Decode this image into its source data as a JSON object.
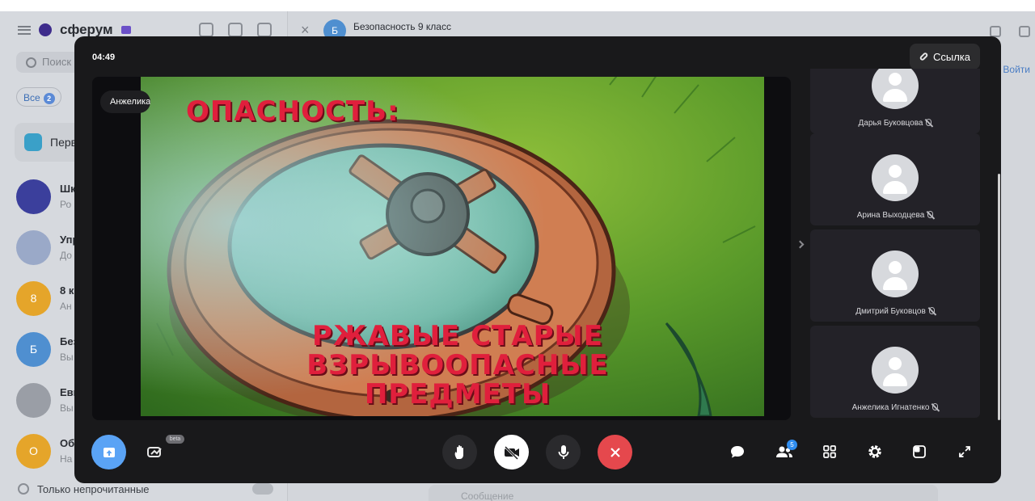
{
  "background_app": {
    "logo_text": "сферум",
    "search_placeholder": "Поиск",
    "filter_label": "Все",
    "filter_count": "2",
    "pinned_label": "Перв",
    "chats": [
      {
        "name": "Шк",
        "sub": "Ро",
        "avatar_text": "",
        "color": "#3b3f9c"
      },
      {
        "name": "Упр",
        "sub": "До",
        "avatar_text": "",
        "color": "#9aa9c8"
      },
      {
        "name": "8 к",
        "sub": "Ан",
        "avatar_text": "8",
        "color": "#e5a52a"
      },
      {
        "name": "Без",
        "sub": "Вы",
        "avatar_text": "Б",
        "color": "#4f8fd0"
      },
      {
        "name": "Евг",
        "sub": "Вы",
        "avatar_text": "",
        "color": "#9a9ea6"
      },
      {
        "name": "Об",
        "sub": "На",
        "avatar_text": "О",
        "color": "#e5a52a"
      }
    ],
    "unread_only_label": "Только непрочитанные",
    "chat_title": "Безопасность 9 класс",
    "chat_avatar_text": "Б",
    "join_label": "Войти",
    "message_placeholder": "Сообщение"
  },
  "call": {
    "timer": "04:49",
    "link_label": "Ссылка",
    "speaker_name": "Анжелика",
    "slide": {
      "title": "ОПАСНОСТЬ:",
      "caption_line1": "РЖАВЫЕ СТАРЫЕ",
      "caption_line2": "ВЗРЫВООПАСНЫЕ ПРЕДМЕТЫ"
    },
    "participants": [
      {
        "name": "Дарья Буковцова"
      },
      {
        "name": "Арина Выходцева"
      },
      {
        "name": "Дмитрий Буковцов"
      },
      {
        "name": "Анжелика Игнатенко"
      }
    ],
    "controls": {
      "beta_label": "beta",
      "participants_count": "5"
    },
    "colors": {
      "accent_blue": "#5aa3f5",
      "end_call_red": "#e5484d",
      "modal_bg": "#19191b"
    }
  }
}
